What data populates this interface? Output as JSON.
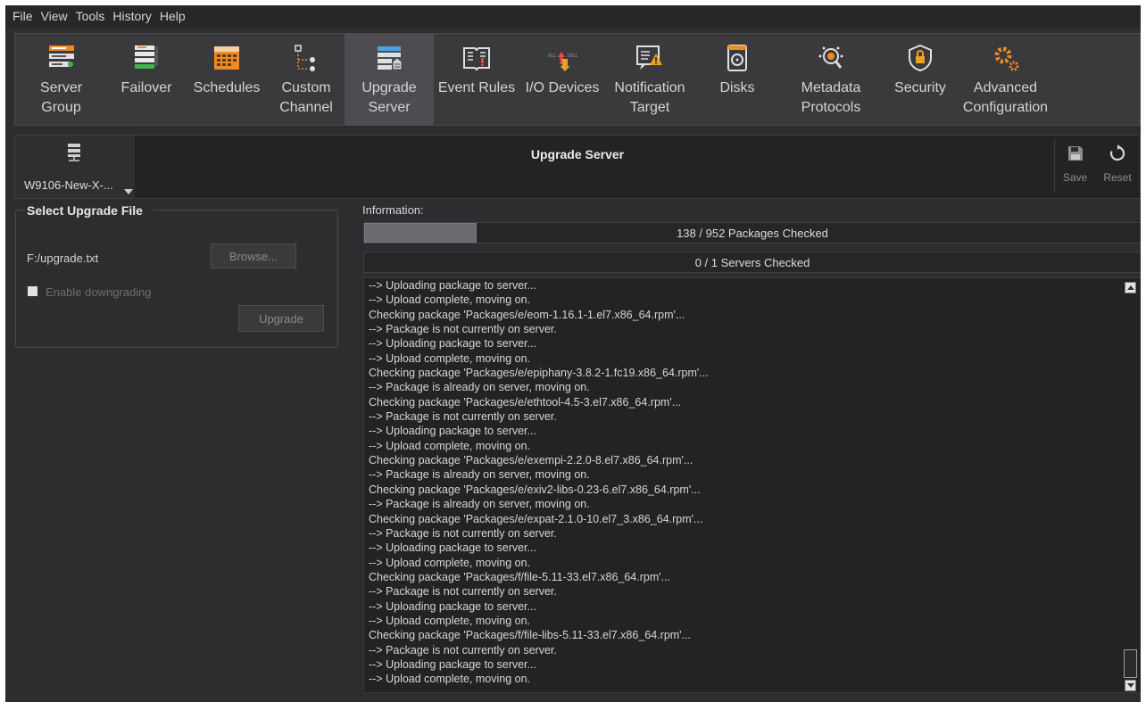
{
  "menu": [
    "File",
    "View",
    "Tools",
    "History",
    "Help"
  ],
  "toolbar": {
    "items": [
      {
        "label": [
          "Server",
          "Group"
        ],
        "icon": "server-group-icon"
      },
      {
        "label": [
          "Failover"
        ],
        "icon": "failover-icon"
      },
      {
        "label": [
          "Schedules"
        ],
        "icon": "schedules-icon"
      },
      {
        "label": [
          "Custom",
          "Channel"
        ],
        "icon": "custom-channel-icon"
      },
      {
        "label": [
          "Upgrade",
          "Server"
        ],
        "icon": "upgrade-server-icon",
        "active": true
      },
      {
        "label": [
          "Event Rules"
        ],
        "icon": "event-rules-icon"
      },
      {
        "label": [
          "I/O Devices"
        ],
        "icon": "io-devices-icon"
      },
      {
        "label": [
          "Notification",
          "Target"
        ],
        "icon": "notification-target-icon"
      },
      {
        "label": [
          "Disks"
        ],
        "icon": "disks-icon"
      },
      {
        "label": [
          "Metadata",
          "Protocols"
        ],
        "icon": "metadata-protocols-icon"
      },
      {
        "label": [
          "Security"
        ],
        "icon": "security-icon"
      },
      {
        "label": [
          "Advanced",
          "Configuration"
        ],
        "icon": "advanced-configuration-icon"
      }
    ]
  },
  "header": {
    "server_name": "W9106-New-X-...",
    "title": "Upgrade Server",
    "save_label": "Save",
    "reset_label": "Reset"
  },
  "upgrade_panel": {
    "title": "Select Upgrade File",
    "file_path": "F:/upgrade.txt",
    "browse_label": "Browse...",
    "downgrade_label": "Enable downgrading",
    "downgrade_checked": false,
    "upgrade_label": "Upgrade"
  },
  "information": {
    "label": "Information:",
    "packages_progress": {
      "text": "138 / 952 Packages Checked",
      "checked": 138,
      "total": 952
    },
    "servers_progress": {
      "text": "0 / 1 Servers Checked",
      "checked": 0,
      "total": 1
    },
    "log_lines": [
      "--> Uploading package to server...",
      "--> Upload complete, moving on.",
      "Checking package 'Packages/e/eom-1.16.1-1.el7.x86_64.rpm'...",
      "--> Package is not currently on server.",
      "--> Uploading package to server...",
      "--> Upload complete, moving on.",
      "Checking package 'Packages/e/epiphany-3.8.2-1.fc19.x86_64.rpm'...",
      "--> Package is already on server, moving on.",
      "Checking package 'Packages/e/ethtool-4.5-3.el7.x86_64.rpm'...",
      "--> Package is not currently on server.",
      "--> Uploading package to server...",
      "--> Upload complete, moving on.",
      "Checking package 'Packages/e/exempi-2.2.0-8.el7.x86_64.rpm'...",
      "--> Package is already on server, moving on.",
      "Checking package 'Packages/e/exiv2-libs-0.23-6.el7.x86_64.rpm'...",
      "--> Package is already on server, moving on.",
      "Checking package 'Packages/e/expat-2.1.0-10.el7_3.x86_64.rpm'...",
      "--> Package is not currently on server.",
      "--> Uploading package to server...",
      "--> Upload complete, moving on.",
      "Checking package 'Packages/f/file-5.11-33.el7.x86_64.rpm'...",
      "--> Package is not currently on server.",
      "--> Uploading package to server...",
      "--> Upload complete, moving on.",
      "Checking package 'Packages/f/file-libs-5.11-33.el7.x86_64.rpm'...",
      "--> Package is not currently on server.",
      "--> Uploading package to server...",
      "--> Upload complete, moving on."
    ]
  },
  "colors": {
    "background": "#2d2d30",
    "toolbar_bg": "#3a3a3d",
    "active_tool_bg": "#4d4d51",
    "accent_orange": "#f08a24",
    "accent_green": "#3fb34f",
    "progress_fill": "#6a6a70"
  }
}
